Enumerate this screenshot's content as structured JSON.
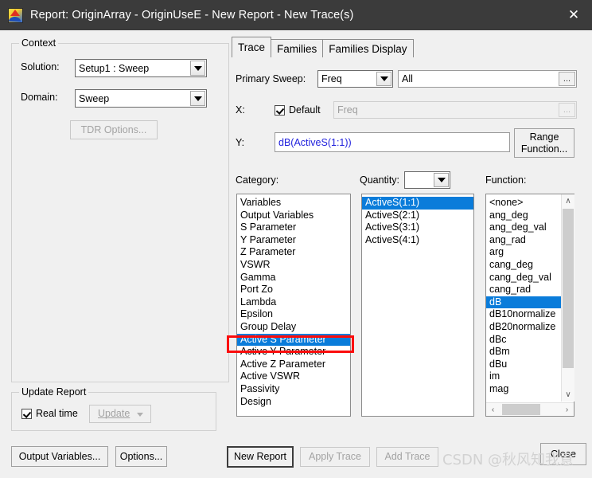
{
  "window": {
    "title": "Report: OriginArray - OriginUseE - New Report - New Trace(s)",
    "close_glyph": "✕",
    "icon_name": "hfss-report-icon"
  },
  "context": {
    "group_label": "Context",
    "solution_label": "Solution:",
    "solution_value": "Setup1 : Sweep",
    "domain_label": "Domain:",
    "domain_value": "Sweep",
    "tdr_options_label": "TDR Options..."
  },
  "update_report": {
    "group_label": "Update Report",
    "realtime_label": "Real time",
    "realtime_checked": true,
    "update_label": "Update"
  },
  "left_buttons": {
    "output_variables": "Output Variables...",
    "options": "Options..."
  },
  "tabs": [
    {
      "label": "Trace",
      "active": true
    },
    {
      "label": "Families",
      "active": false
    },
    {
      "label": "Families Display",
      "active": false
    }
  ],
  "trace": {
    "primary_sweep_label": "Primary Sweep:",
    "primary_sweep_value": "Freq",
    "primary_sweep_range": "All",
    "range_dots": "...",
    "x_label": "X:",
    "x_default_label": "Default",
    "x_default_checked": true,
    "x_value": "Freq",
    "y_label": "Y:",
    "y_value": "dB(ActiveS(1:1))",
    "y_value_color": "#2222dd",
    "range_function_line1": "Range",
    "range_function_line2": "Function..."
  },
  "category": {
    "label": "Category:",
    "items": [
      "Variables",
      "Output Variables",
      "S Parameter",
      "Y Parameter",
      "Z Parameter",
      "VSWR",
      "Gamma",
      "Port Zo",
      "Lambda",
      "Epsilon",
      "Group Delay",
      "Active S Parameter",
      "Active Y Parameter",
      "Active Z Parameter",
      "Active VSWR",
      "Passivity",
      "Design"
    ],
    "selected_index": 11
  },
  "quantity": {
    "label": "Quantity:",
    "combo_value": "",
    "items": [
      "ActiveS(1:1)",
      "ActiveS(2:1)",
      "ActiveS(3:1)",
      "ActiveS(4:1)"
    ],
    "selected_index": 0
  },
  "function": {
    "label": "Function:",
    "items": [
      "<none>",
      "ang_deg",
      "ang_deg_val",
      "ang_rad",
      "arg",
      "cang_deg",
      "cang_deg_val",
      "cang_rad",
      "dB",
      "dB10normalize",
      "dB20normalize",
      "dBc",
      "dBm",
      "dBu",
      "im",
      "mag"
    ],
    "selected_index": 8,
    "scroll_up_glyph": "∧",
    "scroll_down_glyph": "∨",
    "scroll_left_glyph": "‹",
    "scroll_right_glyph": "›"
  },
  "bottom_buttons": {
    "new_report": "New Report",
    "apply_trace": "Apply Trace",
    "add_trace": "Add Trace",
    "close": "Close"
  },
  "watermark": {
    "text": "CSDN @秋风知我意"
  },
  "colors": {
    "selection_blue": "#0a7cda",
    "annotation_red": "#fb0c0c",
    "titlebar": "#3b3b3b",
    "dialog_face": "#f0f0f0"
  }
}
